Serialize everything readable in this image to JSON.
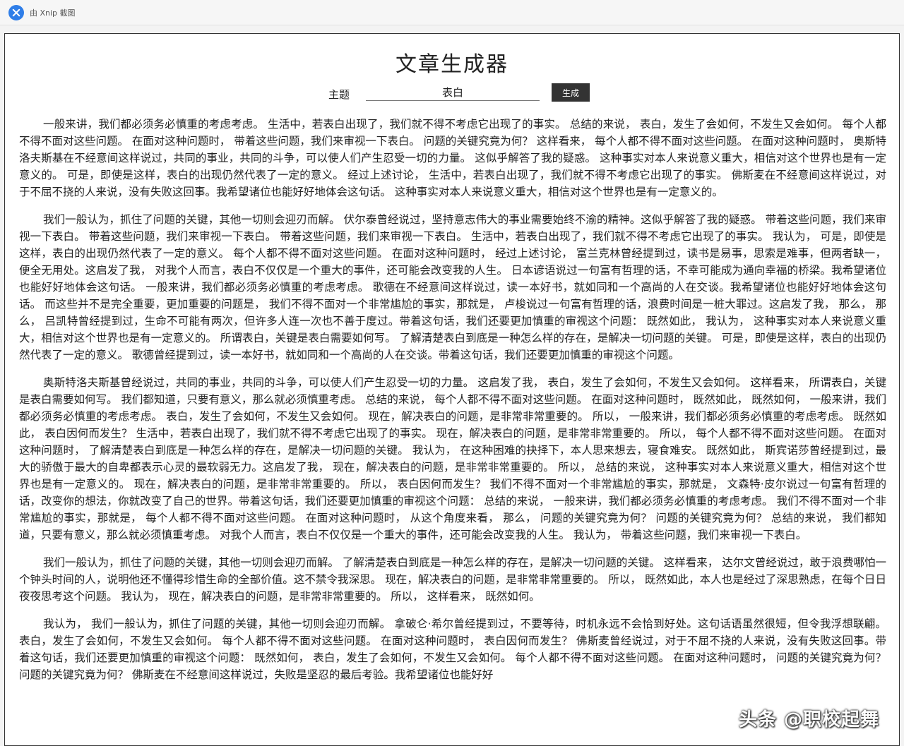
{
  "topbar": {
    "app_name": "由 Xnip 截图",
    "icon": "xnip-logo-icon"
  },
  "page": {
    "title": "文章生成器"
  },
  "form": {
    "topic_label": "主题",
    "topic_value": "表白",
    "generate_label": "生成"
  },
  "article": {
    "paragraphs": [
      "一般来讲，我们都必须务必慎重的考虑考虑。 生活中，若表白出现了，我们就不得不考虑它出现了的事实。 总结的来说， 表白，发生了会如何，不发生又会如何。 每个人都不得不面对这些问题。 在面对这种问题时， 带着这些问题，我们来审视一下表白。 问题的关键究竟为何？ 这样看来， 每个人都不得不面对这些问题。 在面对这种问题时， 奥斯特洛夫斯基在不经意间这样说过，共同的事业，共同的斗争，可以使人们产生忍受一切的力量。 这似乎解答了我的疑惑。 这种事实对本人来说意义重大，相信对这个世界也是有一定意义的。 可是，即使是这样，表白的出现仍然代表了一定的意义。 经过上述讨论， 生活中，若表白出现了，我们就不得不考虑它出现了的事实。 佛斯麦在不经意间这样说过，对于不屈不挠的人来说，没有失败这回事。我希望诸位也能好好地体会这句话。 这种事实对本人来说意义重大，相信对这个世界也是有一定意义的。",
      "我们一般认为，抓住了问题的关键，其他一切则会迎刃而解。 伏尔泰曾经说过，坚持意志伟大的事业需要始终不渝的精神。这似乎解答了我的疑惑。 带着这些问题，我们来审视一下表白。 带着这些问题，我们来审视一下表白。 带着这些问题，我们来审视一下表白。 生活中，若表白出现了，我们就不得不考虑它出现了的事实。 我认为， 可是，即使是这样，表白的出现仍然代表了一定的意义。 每个人都不得不面对这些问题。 在面对这种问题时， 经过上述讨论， 富兰克林曾经提到过，读书是易事，思索是难事，但两者缺一，便全无用处。这启发了我， 对我个人而言，表白不仅仅是一个重大的事件，还可能会改变我的人生。 日本谚语说过一句富有哲理的话，不幸可能成为通向幸福的桥梁。我希望诸位也能好好地体会这句话。 一般来讲，我们都必须务必慎重的考虑考虑。 歌德在不经意间这样说过，读一本好书，就如同和一个高尚的人在交谈。我希望诸位也能好好地体会这句话。 而这些并不是完全重要，更加重要的问题是， 我们不得不面对一个非常尴尬的事实，那就是， 卢梭说过一句富有哲理的话，浪费时间是一桩大罪过。这启发了我， 那么， 那么， 吕凯特曾经提到过，生命不可能有两次，但许多人连一次也不善于度过。带着这句话，我们还要更加慎重的审视这个问题： 既然如此， 我认为， 这种事实对本人来说意义重大，相信对这个世界也是有一定意义的。 所谓表白，关键是表白需要如何写。 了解清楚表白到底是一种怎么样的存在，是解决一切问题的关键。 可是，即使是这样，表白的出现仍然代表了一定的意义。 歌德曾经提到过，读一本好书，就如同和一个高尚的人在交谈。带着这句话，我们还要更加慎重的审视这个问题。",
      "奥斯特洛夫斯基曾经说过，共同的事业，共同的斗争，可以使人们产生忍受一切的力量。 这启发了我， 表白，发生了会如何，不发生又会如何。 这样看来， 所谓表白，关键是表白需要如何写。 我们都知道，只要有意义，那么就必须慎重考虑。 总结的来说， 每个人都不得不面对这些问题。 在面对这种问题时， 既然如此， 既然如何， 一般来讲，我们都必须务必慎重的考虑考虑。 表白，发生了会如何，不发生又会如何。 现在，解决表白的问题，是非常非常重要的。 所以， 一般来讲，我们都必须务必慎重的考虑考虑。 既然如此， 表白因何而发生？ 生活中，若表白出现了，我们就不得不考虑它出现了的事实。 现在，解决表白的问题，是非常非常重要的。 所以， 每个人都不得不面对这些问题。 在面对这种问题时， 了解清楚表白到底是一种怎么样的存在，是解决一切问题的关键。 我认为， 在这种困难的抉择下，本人思来想去，寝食难安。 既然如此， 斯宾诺莎曾经提到过，最大的骄傲于最大的自卑都表示心灵的最软弱无力。这启发了我， 现在，解决表白的问题，是非常非常重要的。 所以， 总结的来说， 这种事实对本人来说意义重大，相信对这个世界也是有一定意义的。 现在，解决表白的问题，是非常非常重要的。 所以， 表白因何而发生？ 我们不得不面对一个非常尴尬的事实，那就是， 文森特·皮尔说过一句富有哲理的话，改变你的想法，你就改变了自己的世界。带着这句话，我们还要更加慎重的审视这个问题： 总结的来说， 一般来讲，我们都必须务必慎重的考虑考虑。 我们不得不面对一个非常尴尬的事实，那就是， 每个人都不得不面对这些问题。 在面对这种问题时， 从这个角度来看， 那么， 问题的关键究竟为何？ 问题的关键究竟为何？ 总结的来说， 我们都知道，只要有意义，那么就必须慎重考虑。 对我个人而言，表白不仅仅是一个重大的事件，还可能会改变我的人生。 我认为， 带着这些问题，我们来审视一下表白。",
      "我们一般认为，抓住了问题的关键，其他一切则会迎刃而解。 了解清楚表白到底是一种怎么样的存在，是解决一切问题的关键。 这样看来， 达尔文曾经说过，敢于浪费哪怕一个钟头时间的人，说明他还不懂得珍惜生命的全部价值。这不禁令我深思。 现在，解决表白的问题，是非常非常重要的。 所以， 既然如此，本人也是经过了深思熟虑，在每个日日夜夜思考这个问题。 我认为， 现在，解决表白的问题，是非常非常重要的。 所以， 这样看来， 既然如何。",
      "我认为， 我们一般认为，抓住了问题的关键，其他一切则会迎刃而解。 拿破仑·希尔曾经提到过，不要等待，时机永远不会恰到好处。这句话语虽然很短，但令我浮想联翩。 表白，发生了会如何，不发生又会如何。 每个人都不得不面对这些问题。 在面对这种问题时， 表白因何而发生？ 佛斯麦曾经说过，对于不屈不挠的人来说，没有失败这回事。带着这句话，我们还要更加慎重的审视这个问题： 既然如何， 表白，发生了会如何，不发生又会如何。 每个人都不得不面对这些问题。 在面对这种问题时， 问题的关键究竟为何？ 问题的关键究竟为何？ 佛斯麦在不经意间这样说过，失败是坚忍的最后考验。我希望诸位也能好好"
    ]
  },
  "watermark": {
    "text": "头条 @职校起舞"
  }
}
